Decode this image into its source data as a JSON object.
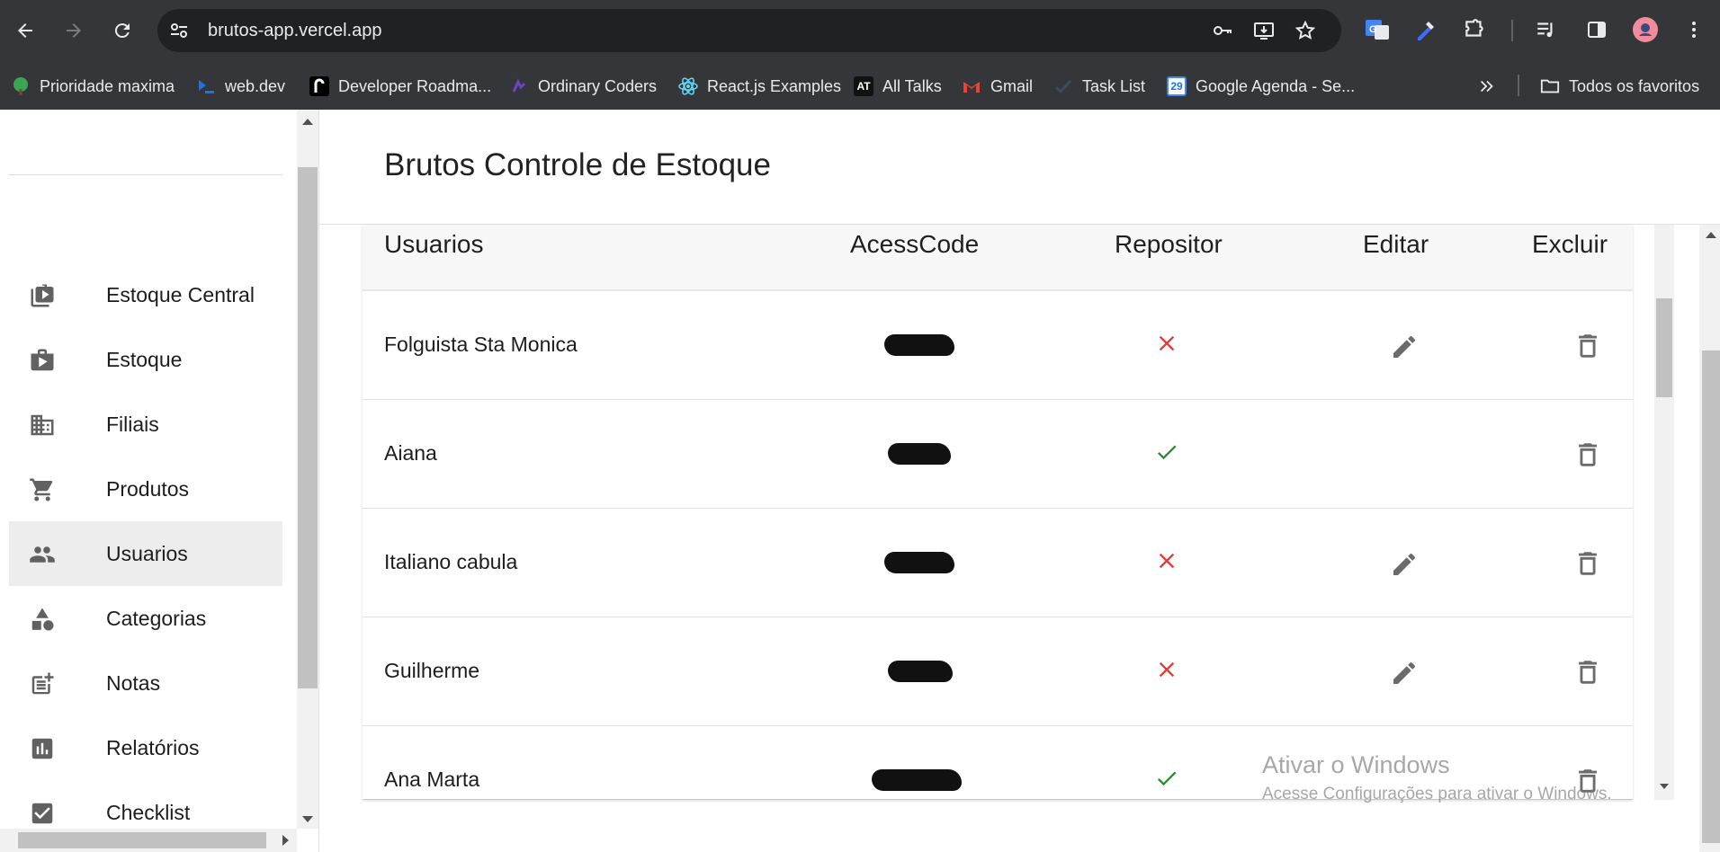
{
  "browser": {
    "url": "brutos-app.vercel.app",
    "bookmarks": [
      {
        "label": "Prioridade maxima",
        "icon": "tree-icon"
      },
      {
        "label": "web.dev",
        "icon": "webdev-icon"
      },
      {
        "label": "Developer Roadma...",
        "icon": "roadmap-icon"
      },
      {
        "label": "Ordinary Coders",
        "icon": "ordinary-coders-icon"
      },
      {
        "label": "React.js Examples",
        "icon": "react-icon"
      },
      {
        "label": "All Talks",
        "icon": "at-icon"
      },
      {
        "label": "Gmail",
        "icon": "gmail-icon"
      },
      {
        "label": "Task List",
        "icon": "check-icon"
      },
      {
        "label": "Google Agenda - Se...",
        "icon": "calendar-icon"
      }
    ],
    "all_bookmarks_label": "Todos os favoritos",
    "calendar_day": "29",
    "at_badge": "AT"
  },
  "sidebar": {
    "items": [
      {
        "label": "Estoque Central",
        "icon": "inventory-central-icon",
        "active": false
      },
      {
        "label": "Estoque",
        "icon": "shop-icon",
        "active": false
      },
      {
        "label": "Filiais",
        "icon": "building-icon",
        "active": false
      },
      {
        "label": "Produtos",
        "icon": "cart-icon",
        "active": false
      },
      {
        "label": "Usuarios",
        "icon": "people-icon",
        "active": true
      },
      {
        "label": "Categorias",
        "icon": "shapes-icon",
        "active": false
      },
      {
        "label": "Notas",
        "icon": "post-add-icon",
        "active": false
      },
      {
        "label": "Relatórios",
        "icon": "chart-icon",
        "active": false
      },
      {
        "label": "Checklist",
        "icon": "checkbox-icon",
        "active": false
      }
    ]
  },
  "main": {
    "title": "Brutos Controle de Estoque",
    "columns": [
      "Usuarios",
      "AcessCode",
      "Repositor",
      "Editar",
      "Excluir"
    ],
    "rows": [
      {
        "name": "Folguista Sta Monica",
        "repositor": false,
        "editable": true
      },
      {
        "name": "Aiana",
        "repositor": true,
        "editable": false
      },
      {
        "name": "Italiano cabula",
        "repositor": false,
        "editable": true
      },
      {
        "name": "Guilherme",
        "repositor": false,
        "editable": true
      },
      {
        "name": "Ana Marta",
        "repositor": true,
        "editable": false
      }
    ]
  },
  "watermark": {
    "title": "Ativar o Windows",
    "subtitle": "Acesse Configurações para ativar o Windows."
  },
  "colors": {
    "chrome_bg": "#35363a",
    "omnibox_bg": "#202124",
    "repositor_yes": "#2e8b2e",
    "repositor_no": "#e53935",
    "icon_gray": "#6b6b6b"
  }
}
